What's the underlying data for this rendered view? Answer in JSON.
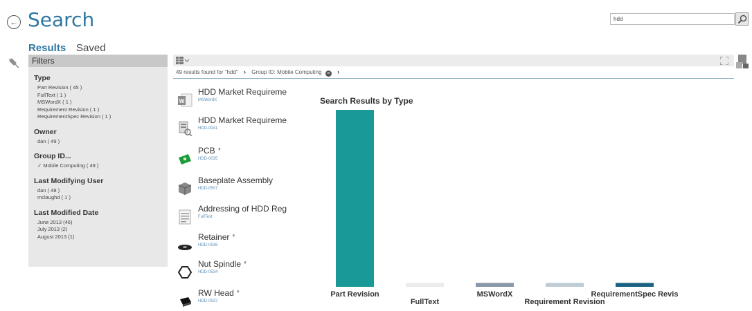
{
  "header": {
    "title": "Search",
    "search_value": "hdd"
  },
  "tabs": {
    "results": "Results",
    "saved": "Saved"
  },
  "filters": {
    "header": "Filters",
    "groups": [
      {
        "title": "Type",
        "items": [
          "Part Revision ( 45 )",
          "FullText ( 1 )",
          "MSWordX ( 1 )",
          "Requirement Revision ( 1 )",
          "RequirementSpec Revision ( 1 )"
        ]
      },
      {
        "title": "Owner",
        "items": [
          "dan ( 49 )"
        ]
      },
      {
        "title": "Group ID...",
        "items": [
          "✓ Mobile Computing ( 49 )"
        ]
      },
      {
        "title": "Last Modifying User",
        "items": [
          "dan ( 48 )",
          "mclaughd ( 1 )"
        ]
      },
      {
        "title": "Last Modified Date",
        "items": [
          "June 2013 (46)",
          "July 2013 (2)",
          "August 2013 (1)"
        ]
      }
    ]
  },
  "breadcrumb": {
    "results": "49 results found for \"hdd\"",
    "group": "Group ID: Mobile Computing"
  },
  "results": [
    {
      "name": "HDD Market Requireme",
      "sub": "MSWordX",
      "icon": "word-doc-icon",
      "locked": false
    },
    {
      "name": "HDD Market Requireme",
      "sub": "HDD-0041",
      "icon": "requirement-icon",
      "locked": false
    },
    {
      "name": "PCB",
      "sub": "HDD-0035",
      "icon": "pcb-icon",
      "locked": true
    },
    {
      "name": "Baseplate Assembly",
      "sub": "HDD-0507",
      "icon": "assembly-icon",
      "locked": false
    },
    {
      "name": "Addressing of HDD Reg",
      "sub": "FullText",
      "icon": "fulltext-doc-icon",
      "locked": false
    },
    {
      "name": "Retainer",
      "sub": "HDD-0536",
      "icon": "retainer-icon",
      "locked": true
    },
    {
      "name": "Nut Spindle",
      "sub": "HDD-0534",
      "icon": "nut-icon",
      "locked": true
    },
    {
      "name": "RW Head",
      "sub": "HDD-0537",
      "icon": "rw-head-icon",
      "locked": true
    }
  ],
  "chart_data": {
    "type": "bar",
    "title": "Search Results by Type",
    "categories": [
      "Part Revision",
      "FullText",
      "MSWordX",
      "Requirement Revision",
      "RequirementSpec Revis"
    ],
    "values": [
      45,
      1,
      1,
      1,
      1
    ],
    "colors": [
      "#199a99",
      "#ebebeb",
      "#8898a8",
      "#bfccd6",
      "#1b6382"
    ],
    "grid": false,
    "legend": "none"
  }
}
